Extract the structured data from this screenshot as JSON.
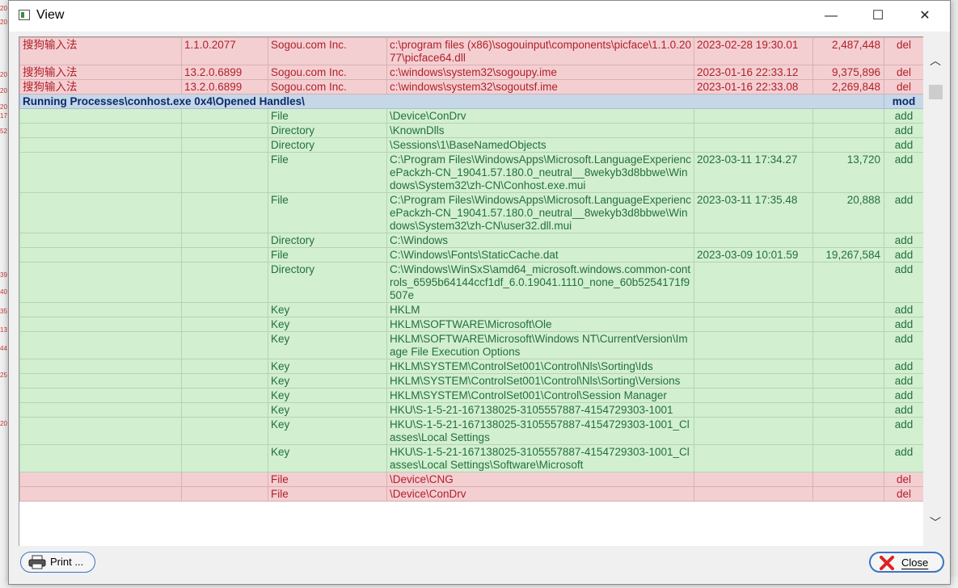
{
  "window": {
    "title": "View",
    "minimize": "—",
    "maximize": "☐",
    "close": "✕"
  },
  "background_left": [
    "20",
    "20",
    "20",
    "20",
    "20",
    "17",
    "52",
    "39",
    "40",
    "35",
    "13",
    "44",
    "25",
    "20"
  ],
  "table": {
    "rows": [
      {
        "type": "red",
        "name": "搜狗输入法",
        "version": "1.1.0.2077",
        "company": "Sogou.com Inc.",
        "path": "c:\\program files (x86)\\sogouinput\\components\\picface\\1.1.0.2077\\picface64.dll",
        "date": "2023-02-28 19:30.01",
        "size": "2,487,448",
        "action": "del"
      },
      {
        "type": "red",
        "name": "搜狗输入法",
        "version": "13.2.0.6899",
        "company": "Sogou.com Inc.",
        "path": "c:\\windows\\system32\\sogoupy.ime",
        "date": "2023-01-16 22:33.12",
        "size": "9,375,896",
        "action": "del"
      },
      {
        "type": "red",
        "name": "搜狗输入法",
        "version": "13.2.0.6899",
        "company": "Sogou.com Inc.",
        "path": "c:\\windows\\system32\\sogoutsf.ime",
        "date": "2023-01-16 22:33.08",
        "size": "2,269,848",
        "action": "del"
      },
      {
        "type": "header",
        "section": "Running Processes\\conhost.exe 0x4\\Opened Handles\\",
        "action": "mod"
      },
      {
        "type": "green",
        "name": "",
        "version": "",
        "company": "File",
        "path": "\\Device\\ConDrv",
        "date": "",
        "size": "",
        "action": "add"
      },
      {
        "type": "green",
        "name": "",
        "version": "",
        "company": "Directory",
        "path": "\\KnownDlls",
        "date": "",
        "size": "",
        "action": "add"
      },
      {
        "type": "green",
        "name": "",
        "version": "",
        "company": "Directory",
        "path": "\\Sessions\\1\\BaseNamedObjects",
        "date": "",
        "size": "",
        "action": "add"
      },
      {
        "type": "green",
        "name": "",
        "version": "",
        "company": "File",
        "path": "C:\\Program Files\\WindowsApps\\Microsoft.LanguageExperiencePackzh-CN_19041.57.180.0_neutral__8wekyb3d8bbwe\\Windows\\System32\\zh-CN\\Conhost.exe.mui",
        "date": "2023-03-11 17:34.27",
        "size": "13,720",
        "action": "add"
      },
      {
        "type": "green",
        "name": "",
        "version": "",
        "company": "File",
        "path": "C:\\Program Files\\WindowsApps\\Microsoft.LanguageExperiencePackzh-CN_19041.57.180.0_neutral__8wekyb3d8bbwe\\Windows\\System32\\zh-CN\\user32.dll.mui",
        "date": "2023-03-11 17:35.48",
        "size": "20,888",
        "action": "add"
      },
      {
        "type": "green",
        "name": "",
        "version": "",
        "company": "Directory",
        "path": "C:\\Windows",
        "date": "",
        "size": "",
        "action": "add"
      },
      {
        "type": "green",
        "name": "",
        "version": "",
        "company": "File",
        "path": "C:\\Windows\\Fonts\\StaticCache.dat",
        "date": "2023-03-09 10:01.59",
        "size": "19,267,584",
        "action": "add"
      },
      {
        "type": "green",
        "name": "",
        "version": "",
        "company": "Directory",
        "path": "C:\\Windows\\WinSxS\\amd64_microsoft.windows.common-controls_6595b64144ccf1df_6.0.19041.1110_none_60b5254171f9507e",
        "date": "",
        "size": "",
        "action": "add"
      },
      {
        "type": "green",
        "name": "",
        "version": "",
        "company": "Key",
        "path": "HKLM",
        "date": "",
        "size": "",
        "action": "add"
      },
      {
        "type": "green",
        "name": "",
        "version": "",
        "company": "Key",
        "path": "HKLM\\SOFTWARE\\Microsoft\\Ole",
        "date": "",
        "size": "",
        "action": "add"
      },
      {
        "type": "green",
        "name": "",
        "version": "",
        "company": "Key",
        "path": "HKLM\\SOFTWARE\\Microsoft\\Windows NT\\CurrentVersion\\Image File Execution Options",
        "date": "",
        "size": "",
        "action": "add"
      },
      {
        "type": "green",
        "name": "",
        "version": "",
        "company": "Key",
        "path": "HKLM\\SYSTEM\\ControlSet001\\Control\\Nls\\Sorting\\Ids",
        "date": "",
        "size": "",
        "action": "add"
      },
      {
        "type": "green",
        "name": "",
        "version": "",
        "company": "Key",
        "path": "HKLM\\SYSTEM\\ControlSet001\\Control\\Nls\\Sorting\\Versions",
        "date": "",
        "size": "",
        "action": "add"
      },
      {
        "type": "green",
        "name": "",
        "version": "",
        "company": "Key",
        "path": "HKLM\\SYSTEM\\ControlSet001\\Control\\Session Manager",
        "date": "",
        "size": "",
        "action": "add"
      },
      {
        "type": "green",
        "name": "",
        "version": "",
        "company": "Key",
        "path": "HKU\\S-1-5-21-167138025-3105557887-4154729303-1001",
        "date": "",
        "size": "",
        "action": "add"
      },
      {
        "type": "green",
        "name": "",
        "version": "",
        "company": "Key",
        "path": "HKU\\S-1-5-21-167138025-3105557887-4154729303-1001_Classes\\Local Settings",
        "date": "",
        "size": "",
        "action": "add"
      },
      {
        "type": "green",
        "name": "",
        "version": "",
        "company": "Key",
        "path": "HKU\\S-1-5-21-167138025-3105557887-4154729303-1001_Classes\\Local Settings\\Software\\Microsoft",
        "date": "",
        "size": "",
        "action": "add"
      },
      {
        "type": "red",
        "name": "",
        "version": "",
        "company": "File",
        "path": "\\Device\\CNG",
        "date": "",
        "size": "",
        "action": "del"
      },
      {
        "type": "red",
        "name": "",
        "version": "",
        "company": "File",
        "path": "\\Device\\ConDrv",
        "date": "",
        "size": "",
        "action": "del"
      }
    ]
  },
  "scrollbar": {
    "up": "︿",
    "down": "﹀"
  },
  "buttons": {
    "print_label": "Print ...",
    "print_icon": "printer-icon",
    "close_label": "Close",
    "close_icon": "red-x-icon"
  },
  "colors": {
    "deleted_row": "#f4cfd2",
    "added_row": "#d2efd0",
    "section_row": "#c6d7e8",
    "button_border": "#3b74c5"
  }
}
